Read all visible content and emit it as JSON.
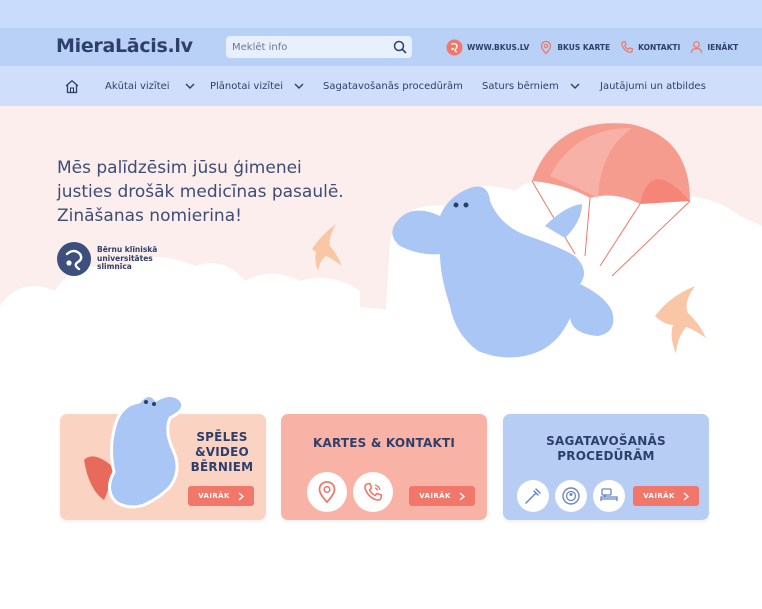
{
  "header": {
    "logo": "MieraLācis.lv",
    "search_placeholder": "Meklēt info",
    "links": [
      {
        "label": "WWW.BKUS.LV",
        "icon": "bkus-circle-icon"
      },
      {
        "label": "BKUS KARTE",
        "icon": "map-pin-icon"
      },
      {
        "label": "KONTAKTI",
        "icon": "phone-icon"
      },
      {
        "label": "IENĀKT",
        "icon": "user-icon"
      }
    ]
  },
  "nav": {
    "home_icon": "home-icon",
    "items": [
      {
        "label": "Akūtai vizītei"
      },
      {
        "label": "Plānotai vizītei"
      },
      {
        "label": "Sagatavošanās procedūrām"
      },
      {
        "label": "Saturs bērniem"
      },
      {
        "label": "Jautājumi un atbildes"
      }
    ]
  },
  "hero": {
    "line1": "Mēs palīdzēsim jūsu ģimenei",
    "line2": "justies drošāk medicīnas pasaulē.",
    "line3": "Zināšanas nomierina!",
    "partner": "Bērnu klīniskā universitātes slimnīca"
  },
  "cards": [
    {
      "title": "SPĒLES &VIDEO BĒRNIEM",
      "title_lines": [
        "SPĒLES",
        "&VIDEO",
        "BĒRNIEM"
      ],
      "button": "VAIRĀK",
      "bg": "#fbd3c2"
    },
    {
      "title": "KARTES & KONTAKTI",
      "button": "VAIRĀK",
      "bg": "#f9b3a6"
    },
    {
      "title": "SAGATAVOŠANĀS PROCEDŪRĀM",
      "title_lines": [
        "SAGATAVOŠANĀS",
        "PROCEDŪRĀM"
      ],
      "button": "VAIRĀK",
      "bg": "#b7cdf4"
    }
  ],
  "colors": {
    "primary": "#2e3f6b",
    "accent": "#f1776a",
    "header_bg": "#b9d0f7",
    "hero_bg": "#fbeeec",
    "bear": "#a9c6f5"
  }
}
